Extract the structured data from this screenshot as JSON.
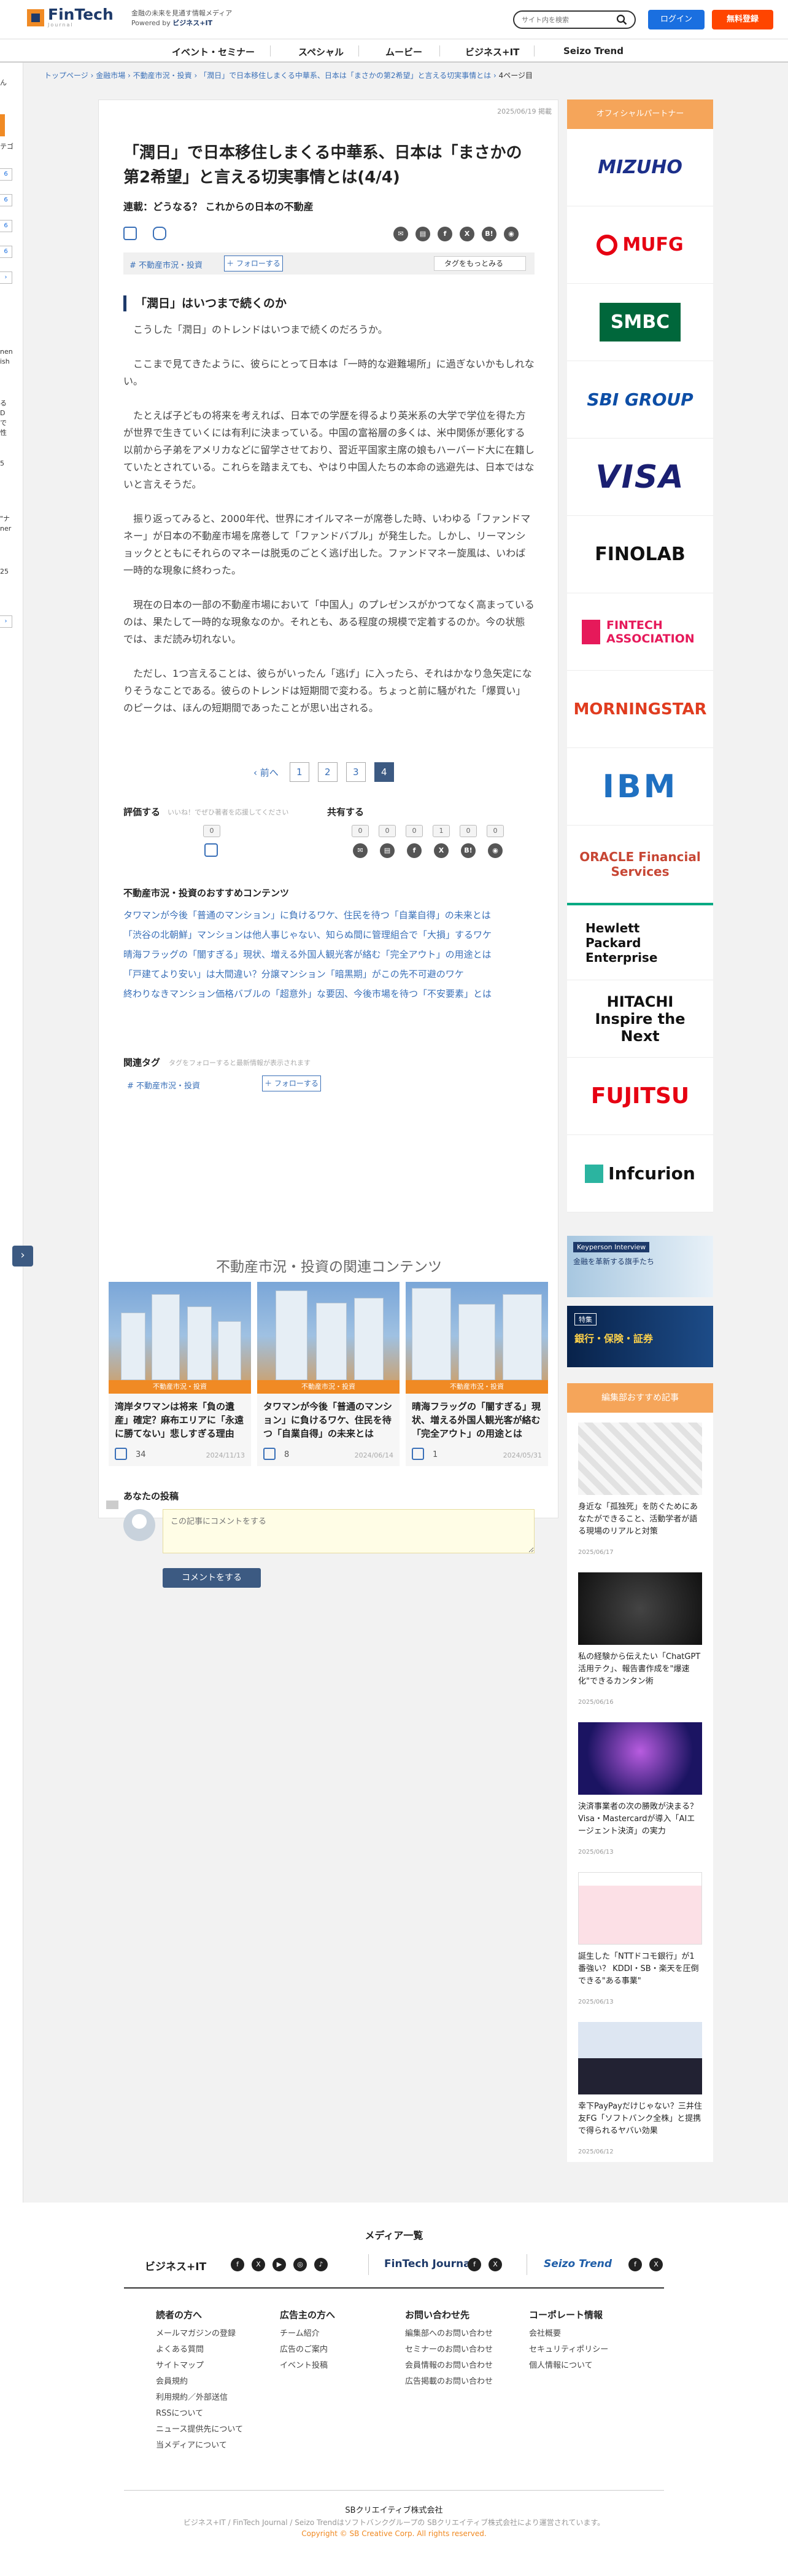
{
  "header": {
    "logo_name": "FinTech",
    "logo_sub": "Journal",
    "tagline_line1": "金融の未来を見通す情報メディア",
    "tagline_poweredby": "Powered by",
    "tagline_brand": "ビジネス+IT",
    "search_placeholder": "サイト内を検索",
    "login_label": "ログイン",
    "register_label": "無料登録"
  },
  "nav": [
    "イベント・セミナー",
    "スペシャル",
    "ムービー",
    "ビジネス+IT",
    "Seizo Trend"
  ],
  "left_stub": {
    "texts": [
      "ん",
      "テゴ",
      "nen",
      "ish",
      "る",
      "D",
      "で",
      "性",
      "6",
      "5",
      "\"ナ",
      "ner",
      "25"
    ],
    "badges": [
      "6",
      "6",
      "6",
      "6"
    ]
  },
  "breadcrumb": [
    "トップページ",
    "金融市場",
    "不動産市況・投資",
    "「潤日」で日本移住しまくる中華系、日本は「まさかの第2希望」と言える切実事情とは",
    "4ページ目"
  ],
  "article": {
    "date": "2025/06/19 掲載",
    "title": "「潤日」で日本移住しまくる中華系、日本は「まさかの第2希望」と言える切実事情とは(4/4)",
    "series": "連載：どうなる？ これからの日本の不動産",
    "tag": "# 不動産市況・投資",
    "follow_label": "＋ フォローする",
    "tag_follow_more": "タグをもっとみる",
    "heading": "「潤日」はいつまで続くのか",
    "paragraphs": [
      "こうした「潤日」のトレンドはいつまで続くのだろうか。",
      "ここまで見てきたように、彼らにとって日本は「一時的な避難場所」に過ぎないかもしれない。",
      "たとえば子どもの将来を考えれば、日本での学歴を得るより英米系の大学で学位を得た方が世界で生きていくには有利に決まっている。中国の富裕層の多くは、米中関係が悪化する以前から子弟をアメリカなどに留学させており、習近平国家主席の娘もハーバード大に在籍していたとされている。これらを踏まえても、やはり中国人たちの本命の逃避先は、日本ではないと言えそうだ。",
      "振り返ってみると、2000年代、世界にオイルマネーが席巻した時、いわゆる「ファンドマネー」が日本の不動産市場を席巻して「ファンドバブル」が発生した。しかし、リーマンショックとともにそれらのマネーは脱兎のごとく逃げ出した。ファンドマネー旋風は、いわば一時的な現象に終わった。",
      "現在の日本の一部の不動産市場において「中国人」のプレゼンスがかつてなく高まっているのは、果たして一時的な現象なのか。それとも、ある程度の規模で定着するのか。今の状態では、まだ読み切れない。",
      "ただし、1つ言えることは、彼らがいったん「逃げ」に入ったら、それはかなり急矢定になりそうなことである。彼らのトレンドは短期間で変わる。ちょっと前に騒がれた「爆買い」のピークは、ほんの短期間であったことが思い出される。"
    ],
    "pager": {
      "prev": "前へ",
      "pages": [
        "1",
        "2",
        "3",
        "4"
      ]
    },
    "rating_label": "評価する",
    "rating_note": "いいね！でぜひ著者を応援してください",
    "rating_count": "0",
    "share_label": "共有する",
    "share_counts": [
      "0",
      "0",
      "0",
      "1",
      "0",
      "0"
    ],
    "rec_heading": "不動産市況・投資のおすすめコンテンツ",
    "rec_links": [
      "タワマンが今後「普通のマンション」に負けるワケ、住民を待つ「自業自得」の未来とは",
      "「渋谷の北朝鮮」マンションは他人事じゃない、知らぬ間に管理組合で「大損」するワケ",
      "晴海フラッグの「闇すぎる」現状、増える外国人観光客が絡む「完全アウト」の用途とは",
      "「戸建てより安い」は大間違い？分譲マンション「暗黒期」がこの先不可避のワケ",
      "終わりなきマンション価格バブルの「超意外」な要因、今後市場を待つ「不安要素」とは"
    ],
    "related_tags_label": "関連タグ",
    "related_tags_note": "タグをフォローすると最新情報が表示されます",
    "related_heading": "不動産市況・投資の関連コンテンツ",
    "cards": [
      {
        "cat": "不動産市況・投資",
        "title": "湾岸タワマンは将来「負の遺産」確定？麻布エリアに「永遠に勝てない」悲しすぎる理由",
        "likes": "34",
        "date": "2024/11/13"
      },
      {
        "cat": "不動産市況・投資",
        "title": "タワマンが今後「普通のマンション」に負けるワケ、住民を待つ「自業自得」の未来とは",
        "likes": "8",
        "date": "2024/06/14"
      },
      {
        "cat": "不動産市況・投資",
        "title": "晴海フラッグの「闇すぎる」現状、増える外国人観光客が絡む「完全アウト」の用途とは",
        "likes": "1",
        "date": "2024/05/31"
      }
    ],
    "comment_heading": "あなたの投稿",
    "comment_placeholder": "この記事にコメントをする",
    "comment_button": "コメントをする"
  },
  "sidebar": {
    "header1": "オフィシャルパートナー",
    "partners": [
      {
        "name": "MIZUHO",
        "color": "#1c2f8a"
      },
      {
        "name": "MUFG",
        "color": "#e60012"
      },
      {
        "name": "SMBC",
        "color": "#ffffff"
      },
      {
        "name": "SBI GROUP",
        "color": "#0d4ea6"
      },
      {
        "name": "VISA",
        "color": "#1a1f71"
      },
      {
        "name": "FINOLAB",
        "color": "#111111"
      },
      {
        "name": "FINTECH ASSOCIATION",
        "color": "#e6195a"
      },
      {
        "name": "MORNINGSTAR",
        "color": "#e03c1f"
      },
      {
        "name": "IBM",
        "color": "#1f70c1"
      },
      {
        "name": "ORACLE Financial Services",
        "color": "#c74634"
      },
      {
        "name": "Hewlett Packard Enterprise",
        "color": "#111111"
      },
      {
        "name": "HITACHI Inspire the Next",
        "color": "#111111"
      },
      {
        "name": "FUJITSU",
        "color": "#e60012"
      },
      {
        "name": "Infcurion",
        "color": "#111111"
      }
    ],
    "kp_tag": "Keyperson Interview",
    "kp_text": "金融を革新する旗手たち",
    "fin_tag": "特集",
    "fin_text": "銀行・保険・証券",
    "header2": "編集部おすすめ記事",
    "recommend": [
      {
        "title": "身近な「孤独死」を防ぐためにあなたができること、活動学者が語る現場のリアルと対策",
        "date": "2025/06/17"
      },
      {
        "title": "私の経験から伝えたい「ChatGPT活用テク」、報告書作成を\"爆速化\"できるカンタン術",
        "date": "2025/06/16"
      },
      {
        "title": "決済事業者の次の勝敗が決まる？ Visa・Mastercardが導入「AIエージェント決済」の実力",
        "date": "2025/06/13"
      },
      {
        "title": "誕生した「NTTドコモ銀行」が1番強い？ KDDI・SB・楽天を圧倒できる\"ある事業\"",
        "date": "2025/06/13"
      },
      {
        "title": "幸下PayPayだけじゃない？三井住友FG「ソフトバンク全株」と提携で得られるヤバい効果",
        "date": "2025/06/12"
      }
    ]
  },
  "footer": {
    "media_heading": "メディア一覧",
    "media": [
      "ビジネス+IT",
      "FinTech Journal",
      "Seizo Trend"
    ],
    "columns": [
      {
        "head": "読者の方へ",
        "items": [
          "メールマガジンの登録",
          "よくある質問",
          "サイトマップ",
          "会員規約",
          "利用規約／外部送信",
          "RSSについて",
          "ニュース提供先について",
          "当メディアについて"
        ]
      },
      {
        "head": "広告主の方へ",
        "items": [
          "チーム紹介",
          "広告のご案内",
          "イベント投稿"
        ]
      },
      {
        "head": "お問い合わせ先",
        "items": [
          "編集部へのお問い合わせ",
          "セミナーのお問い合わせ",
          "会員情報のお問い合わせ",
          "広告掲載のお問い合わせ"
        ]
      },
      {
        "head": "コーポレート情報",
        "items": [
          "会社概要",
          "セキュリティポリシー",
          "個人情報について"
        ]
      }
    ],
    "company": "SBクリエイティブ株式会社",
    "note": "ビジネス+IT / FinTech Journal / Seizo Trendはソフトバンクグループの SBクリエイティブ株式会社により運営されています。",
    "copyright": "Copyright © SB Creative Corp. All rights reserved."
  }
}
